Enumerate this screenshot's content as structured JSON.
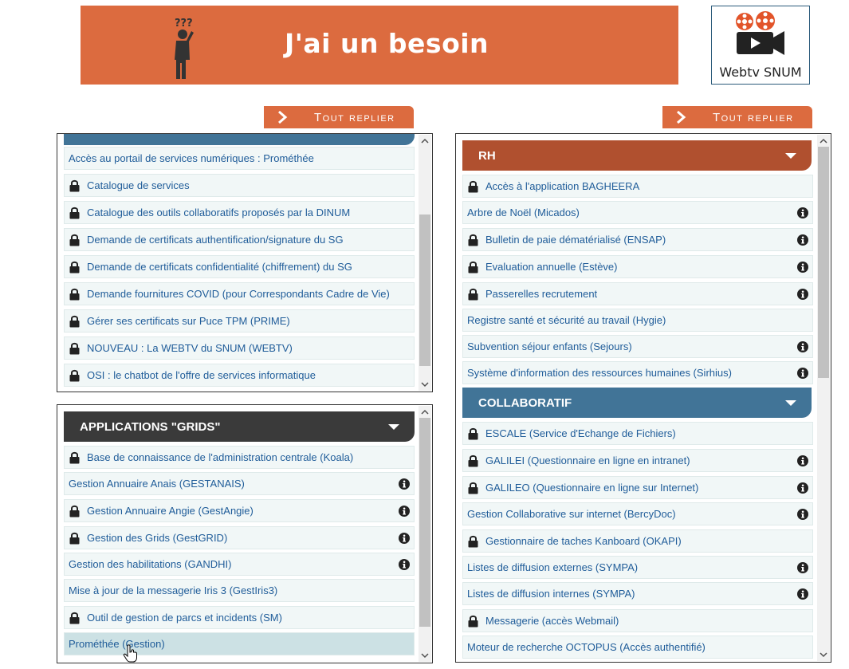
{
  "banner": {
    "title": "J'ai un besoin",
    "color": "#dc6b3f"
  },
  "webtv": {
    "label": "Webtv SNUM"
  },
  "replier_label": "Tout replier",
  "left_top_panel": {
    "header_color": "#417497",
    "items": [
      {
        "label": "Accès au portail de services numériques : Prométhée",
        "lock": false,
        "info": false
      },
      {
        "label": "Catalogue de services",
        "lock": true,
        "info": false
      },
      {
        "label": "Catalogue des outils collaboratifs proposés par la DINUM",
        "lock": true,
        "info": false
      },
      {
        "label": "Demande de certificats authentification/signature du SG",
        "lock": true,
        "info": false
      },
      {
        "label": "Demande de certificats confidentialité (chiffrement) du SG",
        "lock": true,
        "info": false
      },
      {
        "label": "Demande fournitures COVID (pour Correspondants Cadre de Vie)",
        "lock": true,
        "info": false
      },
      {
        "label": "Gérer ses certificats sur Puce TPM (PRIME)",
        "lock": true,
        "info": false
      },
      {
        "label": "NOUVEAU : La WEBTV du SNUM (WEBTV)",
        "lock": true,
        "info": false
      },
      {
        "label": "OSI : le chatbot de l'offre de services informatique",
        "lock": true,
        "info": false
      }
    ]
  },
  "left_bottom_panel": {
    "title": "APPLICATIONS \"GRIDS\"",
    "header_color": "#3a3a3a",
    "items": [
      {
        "label": "Base de connaissance de l'administration centrale (Koala)",
        "lock": true,
        "info": false
      },
      {
        "label": "Gestion Annuaire Anais (GESTANAIS)",
        "lock": false,
        "info": true
      },
      {
        "label": "Gestion Annuaire Angie (GestAngie)",
        "lock": true,
        "info": true
      },
      {
        "label": "Gestion des Grids (GestGRID)",
        "lock": true,
        "info": true
      },
      {
        "label": "Gestion des habilitations (GANDHI)",
        "lock": false,
        "info": true
      },
      {
        "label": "Mise à jour de la messagerie Iris 3 (GestIris3)",
        "lock": false,
        "info": false
      },
      {
        "label": "Outil de gestion de parcs et incidents (SM)",
        "lock": true,
        "info": false
      },
      {
        "label": "Prométhée (Gestion)",
        "lock": false,
        "info": false,
        "hover": true
      }
    ]
  },
  "right_panel": {
    "rh": {
      "title": "RH",
      "header_color": "#b0502f",
      "items": [
        {
          "label": "Accès à l'application BAGHEERA",
          "lock": true,
          "info": false
        },
        {
          "label": "Arbre de Noël (Micados)",
          "lock": false,
          "info": true
        },
        {
          "label": "Bulletin de paie dématérialisé (ENSAP)",
          "lock": true,
          "info": true
        },
        {
          "label": "Evaluation annuelle (Estève)",
          "lock": true,
          "info": true
        },
        {
          "label": "Passerelles recrutement",
          "lock": true,
          "info": true
        },
        {
          "label": "Registre santé et sécurité au travail (Hygie)",
          "lock": false,
          "info": false
        },
        {
          "label": "Subvention séjour enfants (Sejours)",
          "lock": false,
          "info": true
        },
        {
          "label": "Système d'information des ressources humaines (Sirhius)",
          "lock": false,
          "info": true
        }
      ]
    },
    "collaboratif": {
      "title": "COLLABORATIF",
      "header_color": "#417497",
      "items": [
        {
          "label": "ESCALE (Service d'Echange de Fichiers)",
          "lock": true,
          "info": false
        },
        {
          "label": "GALILEI (Questionnaire en ligne en intranet)",
          "lock": true,
          "info": true
        },
        {
          "label": "GALILEO (Questionnaire en ligne sur Internet)",
          "lock": true,
          "info": true
        },
        {
          "label": "Gestion Collaborative sur internet (BercyDoc)",
          "lock": false,
          "info": true
        },
        {
          "label": "Gestionnaire de taches Kanboard (OKAPI)",
          "lock": true,
          "info": false
        },
        {
          "label": "Listes de diffusion externes (SYMPA)",
          "lock": false,
          "info": true
        },
        {
          "label": "Listes de diffusion internes (SYMPA)",
          "lock": false,
          "info": true
        },
        {
          "label": "Messagerie (accès Webmail)",
          "lock": true,
          "info": false
        },
        {
          "label": "Moteur de recherche OCTOPUS (Accès authentifié)",
          "lock": false,
          "info": false
        }
      ]
    }
  }
}
